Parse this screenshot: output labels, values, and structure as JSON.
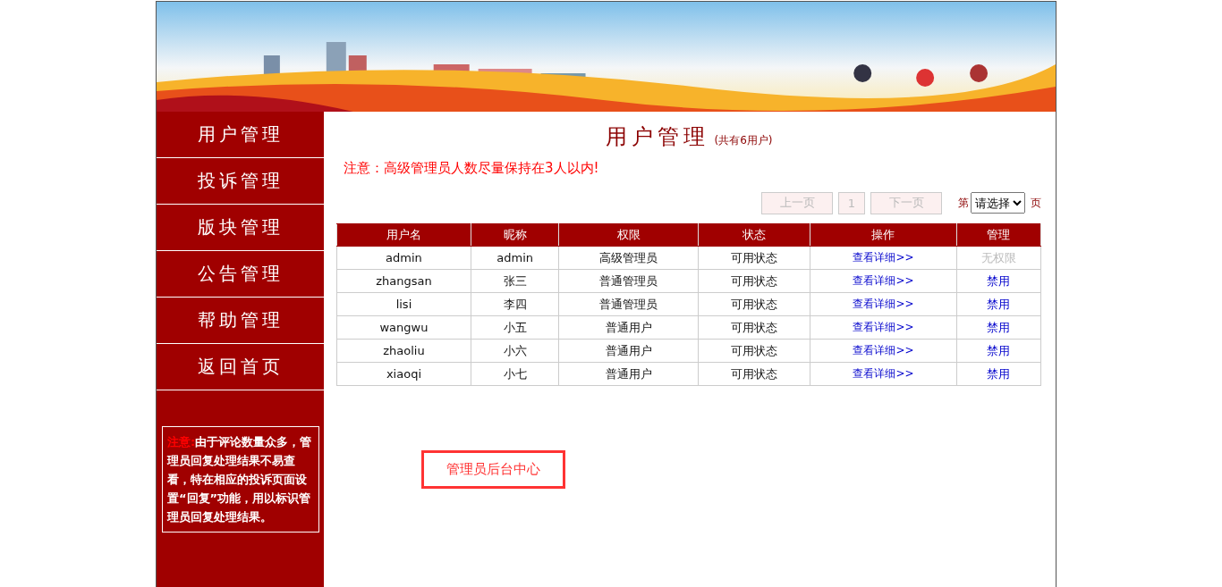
{
  "sidebar": {
    "items": [
      {
        "label": "用户管理"
      },
      {
        "label": "投诉管理"
      },
      {
        "label": "版块管理"
      },
      {
        "label": "公告管理"
      },
      {
        "label": "帮助管理"
      },
      {
        "label": "返回首页"
      }
    ],
    "note": {
      "label": "注意:",
      "text": "由于评论数量众多，管理员回复处理结果不易查看，特在相应的投诉页面设置“回复”功能，用以标识管理员回复处理结果。"
    }
  },
  "main": {
    "title": "用户管理",
    "count": "(共有6用户)",
    "warning": "注意：高级管理员人数尽量保持在3人以内!",
    "pager": {
      "prev": {
        "label": "上一页",
        "disabled": true
      },
      "page": "1",
      "next": {
        "label": "下一页",
        "disabled": true
      },
      "before": "第",
      "select_placeholder": "请选择",
      "after": "页"
    },
    "table": {
      "columns": [
        "用户名",
        "昵称",
        "权限",
        "状态",
        "操作",
        "管理"
      ],
      "rows": [
        {
          "username": "admin",
          "nickname": "admin",
          "role": "高级管理员",
          "status": "可用状态",
          "action": "查看详细>>",
          "manage": "无权限",
          "manage_disabled": true
        },
        {
          "username": "zhangsan",
          "nickname": "张三",
          "role": "普通管理员",
          "status": "可用状态",
          "action": "查看详细>>",
          "manage": "禁用",
          "manage_disabled": false
        },
        {
          "username": "lisi",
          "nickname": "李四",
          "role": "普通管理员",
          "status": "可用状态",
          "action": "查看详细>>",
          "manage": "禁用",
          "manage_disabled": false
        },
        {
          "username": "wangwu",
          "nickname": "小五",
          "role": "普通用户",
          "status": "可用状态",
          "action": "查看详细>>",
          "manage": "禁用",
          "manage_disabled": false
        },
        {
          "username": "zhaoliu",
          "nickname": "小六",
          "role": "普通用户",
          "status": "可用状态",
          "action": "查看详细>>",
          "manage": "禁用",
          "manage_disabled": false
        },
        {
          "username": "xiaoqi",
          "nickname": "小七",
          "role": "普通用户",
          "status": "可用状态",
          "action": "查看详细>>",
          "manage": "禁用",
          "manage_disabled": false
        }
      ]
    },
    "center_button": "管理员后台中心"
  }
}
